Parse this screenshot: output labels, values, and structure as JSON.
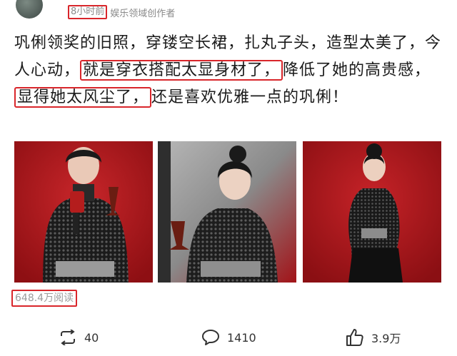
{
  "header": {
    "time": "8小时前",
    "source": "娱乐领域创作者"
  },
  "post": {
    "t1": "巩俐领奖的旧照，穿镂空长裙，扎丸子头，造型太美了，今人心动，",
    "h1": "就是穿衣搭配太显身材了，",
    "t2": "降低了她的高贵感，",
    "h2": "显得她太风尘了，",
    "t3": "还是喜欢优雅一点的巩俐！"
  },
  "stats": {
    "reads": "648.4万阅读"
  },
  "actions": {
    "repost_count": "40",
    "comment_count": "1410",
    "like_count": "3.9万"
  },
  "colors": {
    "highlight": "#d9262b",
    "photo_bg": "#b4161b"
  },
  "icons": [
    "repost-icon",
    "comment-icon",
    "like-icon"
  ]
}
